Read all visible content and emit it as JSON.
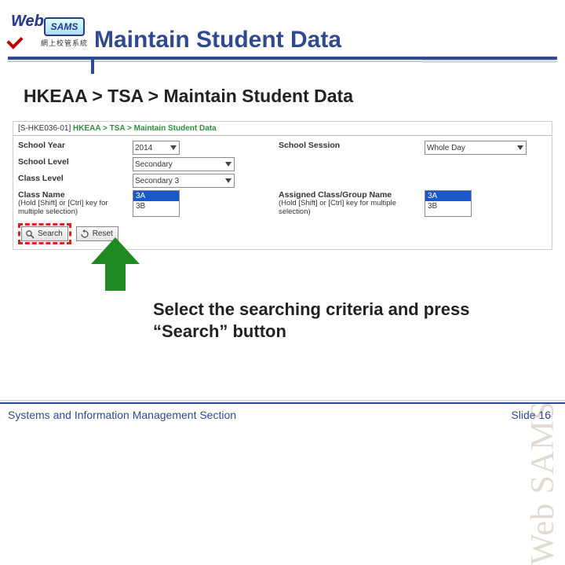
{
  "logo": {
    "word1": "Web",
    "word2": "SAMS",
    "subtitle": "網上校管系統"
  },
  "page_title": "Maintain Student Data",
  "breadcrumb": "HKEAA > TSA > Maintain Student Data",
  "app": {
    "bc_code": "[S-HKE036-01]",
    "bc_path": "HKEAA > TSA > Maintain Student Data",
    "labels": {
      "school_year": "School Year",
      "school_session": "School Session",
      "school_level": "School Level",
      "class_level": "Class Level",
      "class_name": "Class Name",
      "assigned_name": "Assigned Class/Group Name",
      "multi_hint": "(Hold [Shift] or [Ctrl] key for multiple selection)"
    },
    "values": {
      "school_year": "2014",
      "school_session": "Whole Day",
      "school_level": "Secondary",
      "class_level": "Secondary 3",
      "class_name_options": [
        "3A",
        "3B"
      ],
      "assigned_options": [
        "3A",
        "3B"
      ]
    },
    "buttons": {
      "search": "Search",
      "reset": "Reset"
    }
  },
  "instruction": "Select the searching criteria and press “Search” button",
  "watermark": "Web SAMS",
  "footer": {
    "left": "Systems and Information Management Section",
    "right_label": "Slide",
    "slide_no": "16"
  }
}
